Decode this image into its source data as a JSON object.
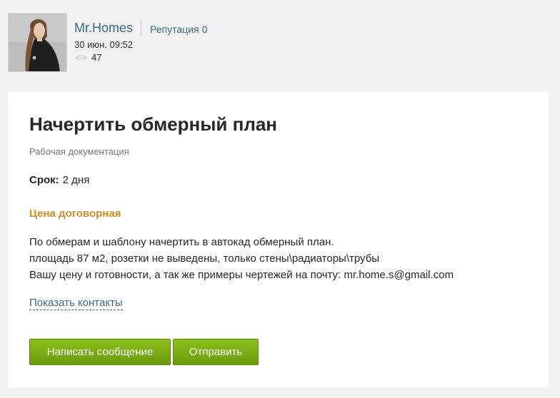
{
  "author": {
    "name": "Mr.Homes",
    "reputation_label": "Репутация",
    "reputation_value": "0",
    "date": "30 июн. 09:52",
    "views": "47"
  },
  "post": {
    "title": "Начертить обмерный план",
    "category": "Рабочая документация",
    "deadline_label": "Срок:",
    "deadline_value": "2 дня",
    "price": "Цена договорная",
    "description_lines": [
      "По обмерам и шаблону начертить в автокад обмерный план.",
      "площадь 87 м2, розетки не выведены, только стены\\радиаторы\\трубы",
      "Вашу цену и готовности, а так же примеры чертежей на почту: mr.home.s@gmail.com"
    ],
    "show_contacts_label": "Показать контакты"
  },
  "actions": {
    "message_label": "Написать сообщение",
    "send_label": "Отправить"
  },
  "colors": {
    "page_bg": "#f2f2f2",
    "card_bg": "#ffffff",
    "link": "#3d6a82",
    "price": "#d18a25",
    "button": "#7bab14"
  },
  "icons": {
    "views": "eye-icon"
  }
}
